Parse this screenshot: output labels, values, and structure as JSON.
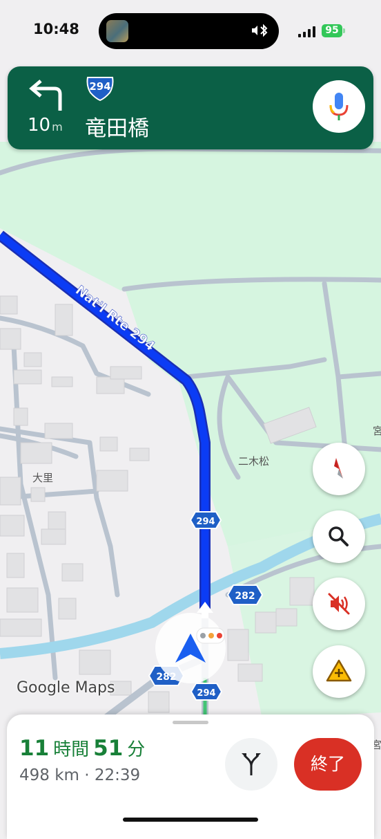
{
  "status_bar": {
    "time": "10:48",
    "battery": "95"
  },
  "nav_banner": {
    "distance_value": "10",
    "distance_unit": "m",
    "route_shield": "294",
    "street_name": "竜田橋"
  },
  "map": {
    "road_label": "Nat'l Rte 294",
    "place_labels": {
      "nikimatsu": "二木松",
      "osato": "大里",
      "edge_right_top": "宮",
      "edge_right_bottom": "宮"
    },
    "shields": {
      "s294_mid": "294",
      "s294_bottom": "294",
      "s282_right": "282",
      "s282_left": "282"
    },
    "attribution": "Google Maps",
    "colors": {
      "route": "#0b3cf5",
      "land_green": "#d6f5e0",
      "road": "#b9c3cf"
    }
  },
  "controls": [
    "compass-icon",
    "search-icon",
    "mute-icon",
    "report-incident-icon"
  ],
  "bottom_sheet": {
    "eta_hours": "11",
    "eta_hours_unit": "時間",
    "eta_minutes": "51",
    "eta_minutes_unit": "分",
    "trip_info": "498 km · 22:39",
    "end_label": "終了"
  }
}
